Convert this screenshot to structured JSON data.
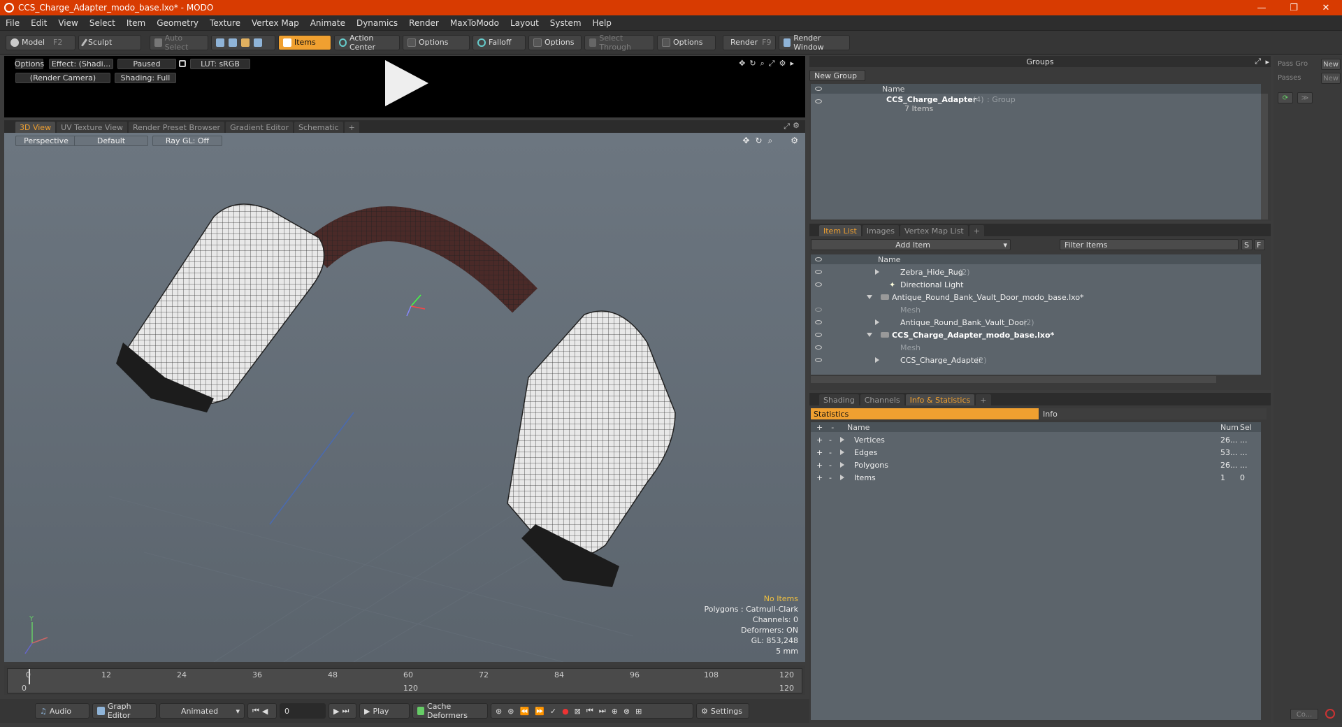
{
  "window": {
    "title": "CCS_Charge_Adapter_modo_base.lxo* - MODO",
    "min": "—",
    "max": "❐",
    "close": "✕"
  },
  "menu": [
    "File",
    "Edit",
    "View",
    "Select",
    "Item",
    "Geometry",
    "Texture",
    "Vertex Map",
    "Animate",
    "Dynamics",
    "Render",
    "MaxToModo",
    "Layout",
    "System",
    "Help"
  ],
  "toolbar": {
    "model": "Model",
    "model_key": "F2",
    "sculpt": "Sculpt",
    "auto_select": "Auto Select",
    "items": "Items",
    "action_center": "Action Center",
    "options1": "Options",
    "falloff": "Falloff",
    "options2": "Options",
    "select_through": "Select Through",
    "options3": "Options",
    "render": "Render",
    "render_key": "F9",
    "render_window": "Render Window"
  },
  "preview": {
    "options": "Options",
    "effect": "Effect: (Shadi...",
    "paused": "Paused",
    "lut": "LUT: sRGB",
    "camera": "(Render Camera)",
    "shading": "Shading: Full"
  },
  "view_tabs": [
    "3D View",
    "UV Texture View",
    "Render Preset Browser",
    "Gradient Editor",
    "Schematic",
    "+"
  ],
  "viewport": {
    "perspective": "Perspective",
    "default": "Default",
    "raygl": "Ray GL: Off",
    "hud": {
      "no_items": "No Items",
      "polygons": "Polygons : Catmull-Clark",
      "channels": "Channels: 0",
      "deformers": "Deformers: ON",
      "gl": "GL: 853,248",
      "scale": "5 mm"
    }
  },
  "timeline": {
    "ticks": [
      "0",
      "12",
      "24",
      "36",
      "48",
      "60",
      "72",
      "84",
      "96",
      "108",
      "120"
    ],
    "start": "0",
    "mid": "120",
    "end": "120"
  },
  "bottombar": {
    "audio": "Audio",
    "graph_editor": "Graph Editor",
    "animated": "Animated",
    "frame": "0",
    "play": "Play",
    "cache": "Cache Deformers",
    "settings": "Settings"
  },
  "groups": {
    "title": "Groups",
    "new_group": "New Group",
    "col_name": "Name",
    "item_name": "CCS_Charge_Adapter",
    "item_count": "(4)",
    "item_type": ": Group",
    "item_sub": "7 Items"
  },
  "item_list": {
    "tabs": [
      "Item List",
      "Images",
      "Vertex Map List",
      "+"
    ],
    "add_item": "Add Item",
    "filter": "Filter Items",
    "s": "S",
    "f": "F",
    "col_name": "Name",
    "rows": [
      {
        "label": "Zebra_Hide_Rug",
        "count": "(2)"
      },
      {
        "label": "Directional Light",
        "count": ""
      },
      {
        "label": "Antique_Round_Bank_Vault_Door_modo_base.lxo*",
        "count": ""
      },
      {
        "label": "Mesh",
        "count": ""
      },
      {
        "label": "Antique_Round_Bank_Vault_Door",
        "count": "(2)"
      },
      {
        "label": "CCS_Charge_Adapter_modo_base.lxo*",
        "count": ""
      },
      {
        "label": "Mesh",
        "count": ""
      },
      {
        "label": "CCS_Charge_Adapter",
        "count": "(2)"
      }
    ]
  },
  "stats": {
    "tabs": [
      "Shading",
      "Channels",
      "Info & Statistics",
      "+"
    ],
    "statistics": "Statistics",
    "info": "Info",
    "col_name": "Name",
    "col_num": "Num",
    "col_sel": "Sel",
    "rows": [
      {
        "name": "Vertices",
        "num": "26...",
        "sel": "..."
      },
      {
        "name": "Edges",
        "num": "53...",
        "sel": "..."
      },
      {
        "name": "Polygons",
        "num": "26...",
        "sel": "..."
      },
      {
        "name": "Items",
        "num": "1",
        "sel": "0"
      }
    ]
  },
  "right_strip": {
    "pass_group": "Pass Gro",
    "new1": "New",
    "passes": "Passes",
    "new2": "New",
    "co": "Co..."
  },
  "colors": {
    "accent": "#f0a030",
    "title": "#d83b01"
  }
}
